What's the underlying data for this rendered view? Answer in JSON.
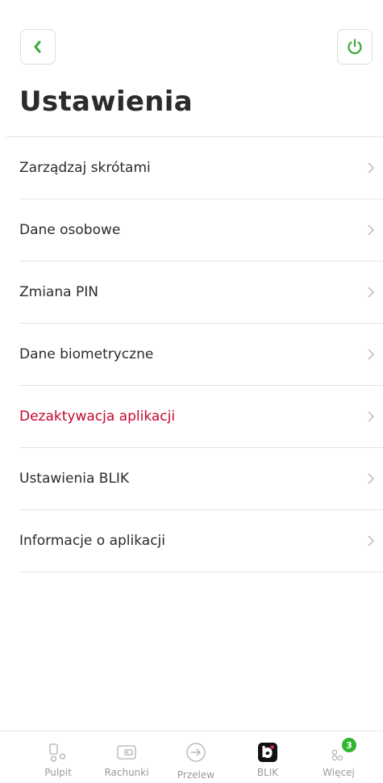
{
  "header": {
    "title": "Ustawienia",
    "back_icon": "chevron-left-icon",
    "power_icon": "power-icon",
    "accent_color": "#3aa93a"
  },
  "menu": {
    "items": [
      {
        "label": "Zarządzaj skrótami",
        "icon": "chevron-right-icon"
      },
      {
        "label": "Dane osobowe",
        "icon": "chevron-right-icon"
      },
      {
        "label": "Zmiana PIN",
        "icon": "chevron-right-icon"
      },
      {
        "label": "Dane biometryczne",
        "icon": "chevron-right-icon"
      },
      {
        "label": "Dezaktywacja aplikacji",
        "icon": "chevron-right-icon",
        "color": "#c3092c"
      },
      {
        "label": "Ustawienia BLIK",
        "icon": "chevron-right-icon"
      },
      {
        "label": "Informacje o aplikacji",
        "icon": "chevron-right-icon"
      }
    ]
  },
  "bottom_nav": {
    "items": [
      {
        "label": "Pulpit",
        "icon": "dashboard-icon"
      },
      {
        "label": "Rachunki",
        "icon": "wallet-icon"
      },
      {
        "label": "Przelew",
        "icon": "transfer-icon"
      },
      {
        "label": "BLIK",
        "icon": "blik-icon"
      },
      {
        "label": "Więcej",
        "icon": "more-icon",
        "badge": "3"
      }
    ]
  }
}
